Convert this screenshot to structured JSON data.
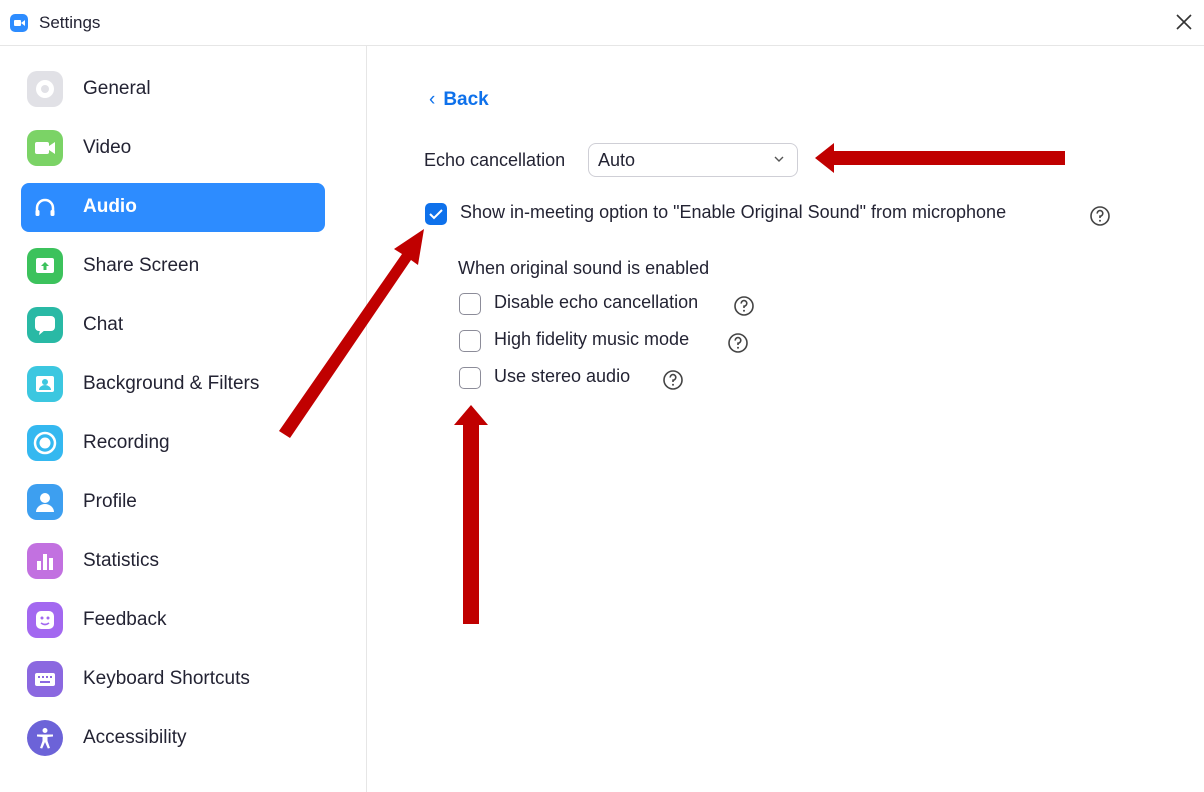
{
  "window": {
    "title": "Settings",
    "app_icon": "zoom-camera-icon",
    "close_icon": "close-icon"
  },
  "sidebar": {
    "active_color": "#2d8cff",
    "items": [
      {
        "label": "General",
        "icon": "gear-icon",
        "color": "#e0e0e6"
      },
      {
        "label": "Video",
        "icon": "video-camera-icon",
        "color": "#7bd366"
      },
      {
        "label": "Audio",
        "icon": "headphones-icon",
        "color": "#2d8cff",
        "active": true
      },
      {
        "label": "Share Screen",
        "icon": "share-screen-icon",
        "color": "#3cc25c"
      },
      {
        "label": "Chat",
        "icon": "chat-bubble-icon",
        "color": "#29b9a5"
      },
      {
        "label": "Background & Filters",
        "icon": "background-icon",
        "color": "#3cc7e0"
      },
      {
        "label": "Recording",
        "icon": "record-icon",
        "color": "#34b8f0"
      },
      {
        "label": "Profile",
        "icon": "profile-icon",
        "color": "#3d9ff0"
      },
      {
        "label": "Statistics",
        "icon": "statistics-icon",
        "color": "#c271e0"
      },
      {
        "label": "Feedback",
        "icon": "smiley-icon",
        "color": "#a368f0"
      },
      {
        "label": "Keyboard Shortcuts",
        "icon": "keyboard-icon",
        "color": "#8b68e0"
      },
      {
        "label": "Accessibility",
        "icon": "accessibility-icon",
        "color": "#6c63d8"
      }
    ]
  },
  "main": {
    "back_label": "Back",
    "echo": {
      "label": "Echo cancellation",
      "value": "Auto"
    },
    "original_sound": {
      "label": "Show in-meeting option to \"Enable Original Sound\" from microphone",
      "checked": true
    },
    "sub_heading": "When original sound is enabled",
    "options": [
      {
        "label": "Disable echo cancellation",
        "checked": false
      },
      {
        "label": "High fidelity music mode",
        "checked": false
      },
      {
        "label": "Use stereo audio",
        "checked": false
      }
    ]
  },
  "annotations": {
    "arrow_color": "#c00000"
  }
}
